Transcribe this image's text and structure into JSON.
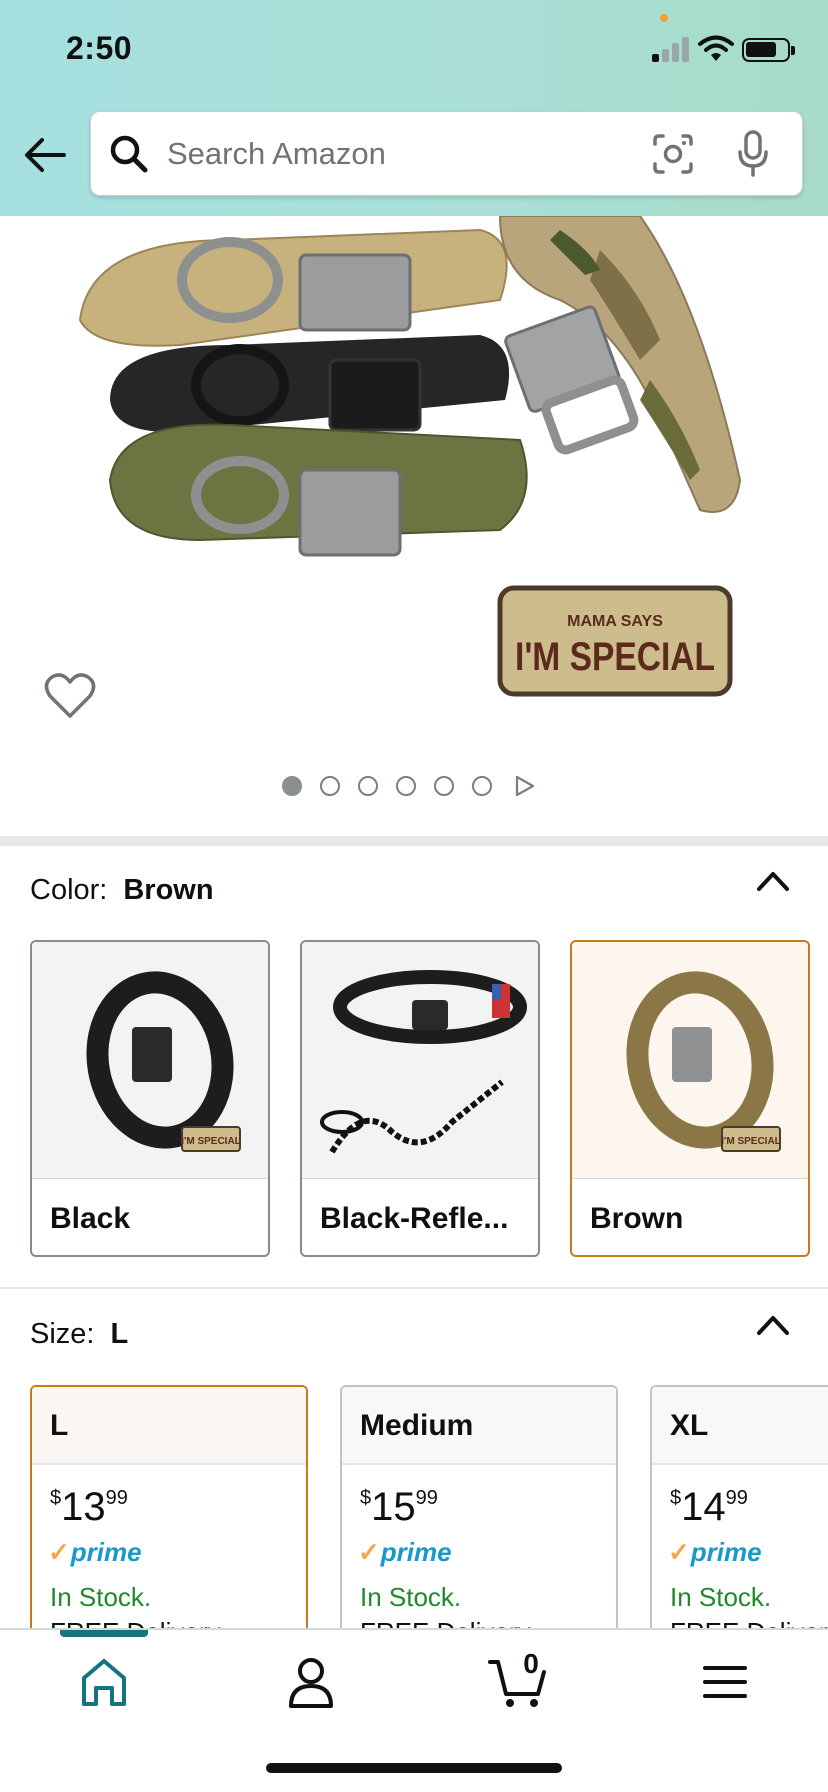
{
  "status_bar": {
    "time": "2:50"
  },
  "search": {
    "placeholder": "Search Amazon"
  },
  "product_image": {
    "patch_text_top": "MAMA SAYS",
    "patch_text_main": "I'M SPECIAL"
  },
  "carousel": {
    "image_count": 6,
    "active_index": 0
  },
  "color": {
    "label": "Color:",
    "selected": "Brown",
    "options": [
      {
        "name": "Black",
        "selected": false
      },
      {
        "name": "Black-Refle...",
        "selected": false
      },
      {
        "name": "Brown",
        "selected": true
      }
    ]
  },
  "size": {
    "label": "Size:",
    "selected": "L",
    "options": [
      {
        "name": "L",
        "currency": "$",
        "whole": "13",
        "cents": "99",
        "prime": "prime",
        "stock": "In Stock.",
        "delivery": "FREE Delivery",
        "selected": true
      },
      {
        "name": "Medium",
        "currency": "$",
        "whole": "15",
        "cents": "99",
        "prime": "prime",
        "stock": "In Stock.",
        "delivery": "FREE Delivery",
        "selected": false
      },
      {
        "name": "XL",
        "currency": "$",
        "whole": "14",
        "cents": "99",
        "prime": "prime",
        "stock": "In Stock.",
        "delivery": "FREE Delivery",
        "selected": false
      }
    ]
  },
  "bottom_nav": {
    "items": [
      "home-icon",
      "account-icon",
      "cart-icon",
      "menu-icon"
    ],
    "active": "home-icon",
    "cart_count": "0"
  },
  "colors": {
    "accent_teal": "#14747f",
    "selected_border": "#c7791e",
    "stock_green": "#1f8a2a",
    "prime_blue": "#1a98c9"
  }
}
